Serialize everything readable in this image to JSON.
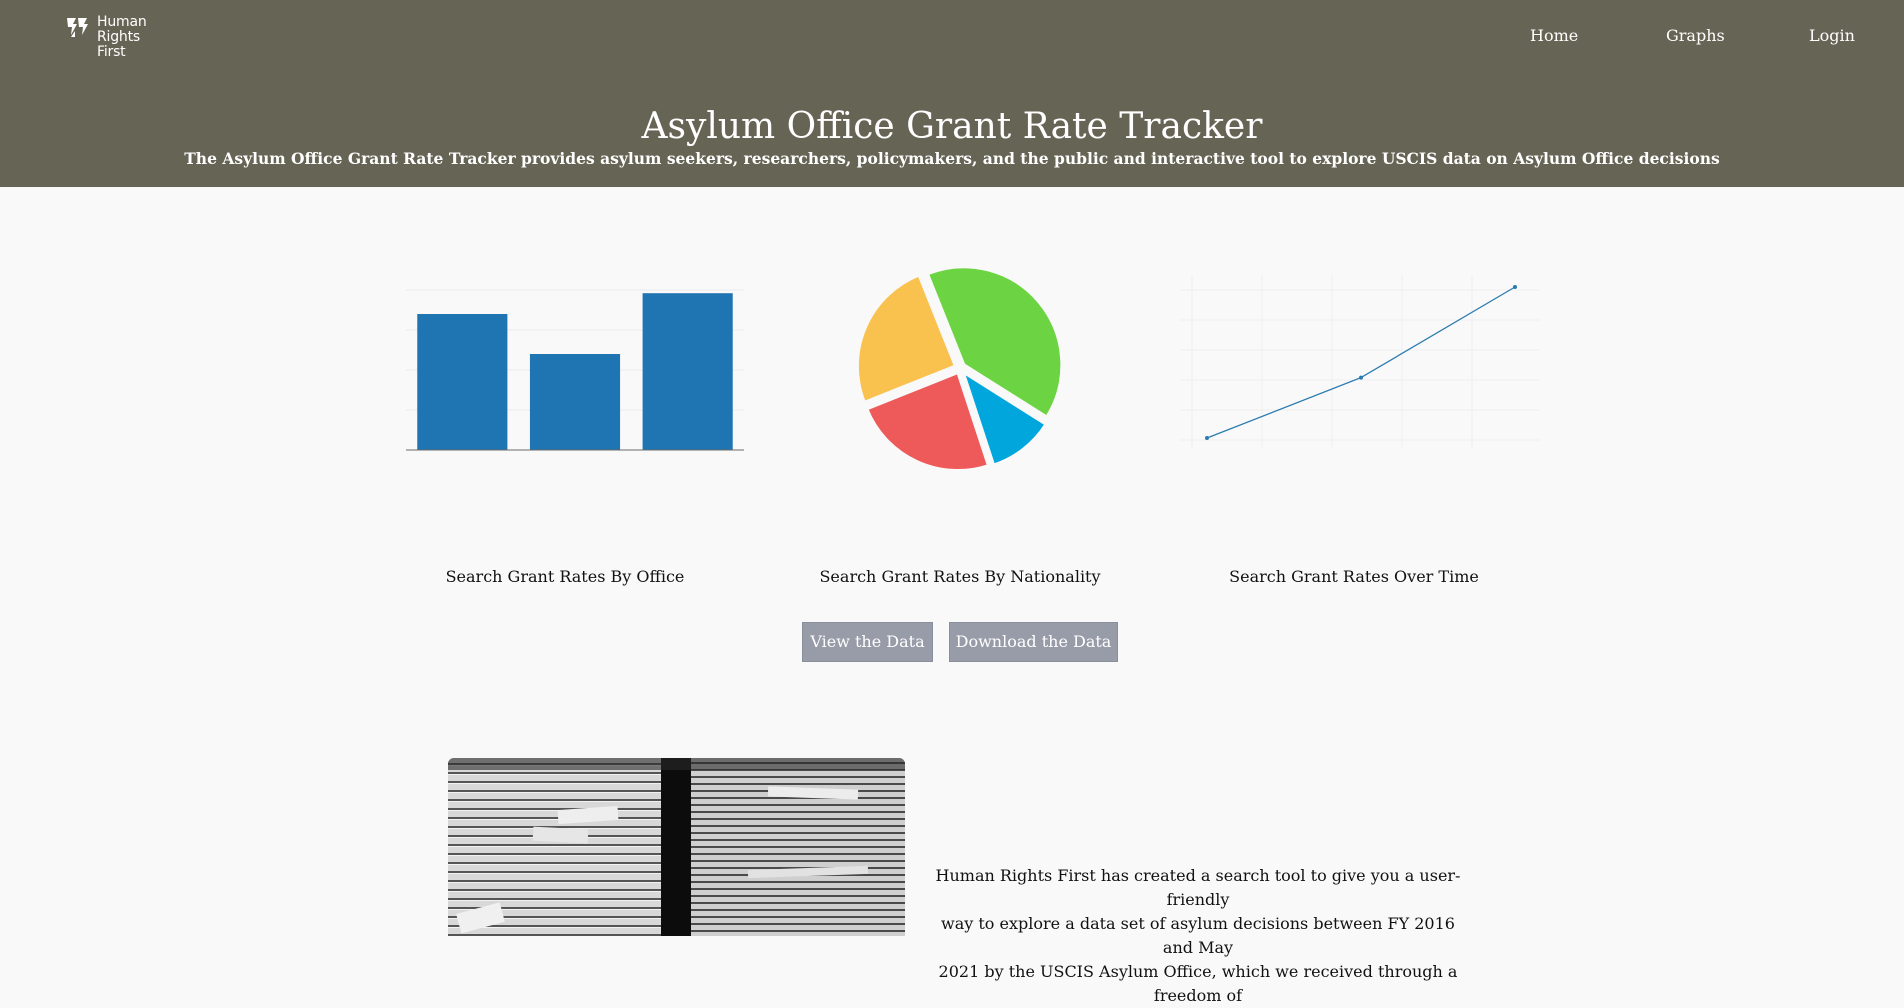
{
  "header": {
    "logo_text": "Human\nRights\nFirst",
    "nav": {
      "home": "Home",
      "graphs": "Graphs",
      "login": "Login"
    },
    "title": "Asylum Office Grant Rate Tracker",
    "subtitle": "The Asylum Office Grant Rate Tracker provides asylum seekers, researchers, policymakers, and the public and interactive tool to explore USCIS data on Asylum Office decisions"
  },
  "colors": {
    "header_bg": "#666555",
    "page_bg": "#f9f9f9",
    "bar_blue": "#1f75b1",
    "pie_green": "#6cd443",
    "pie_blue": "#00a6dc",
    "pie_red": "#ee5a5a",
    "pie_yellow": "#f9c14e",
    "line_blue": "#2b7bb0",
    "button_bg": "#989ca8"
  },
  "cards": [
    {
      "label": "Search Grant Rates By Office"
    },
    {
      "label": "Search Grant Rates By Nationality"
    },
    {
      "label": "Search Grant Rates Over Time"
    }
  ],
  "chart_data": [
    {
      "type": "bar",
      "categories": [
        "",
        "",
        ""
      ],
      "values": [
        85,
        60,
        98
      ],
      "ylim": [
        0,
        100
      ],
      "grid": true,
      "color": "#1f75b1"
    },
    {
      "type": "pie",
      "series": [
        {
          "value": 40,
          "color": "#6cd443"
        },
        {
          "value": 11,
          "color": "#00a6dc"
        },
        {
          "value": 24,
          "color": "#ee5a5a"
        },
        {
          "value": 25,
          "color": "#f9c14e"
        }
      ]
    },
    {
      "type": "line",
      "x": [
        0,
        1,
        2
      ],
      "y": [
        0,
        40,
        100
      ],
      "ylim": [
        0,
        100
      ],
      "grid": true,
      "color": "#2b7bb0"
    }
  ],
  "buttons": {
    "view": "View the Data",
    "download": "Download the Data"
  },
  "intro_text": "Human Rights First has created a search tool to give you a user-friendly\nway to explore a data set of asylum decisions between FY 2016 and May\n2021 by the USCIS Asylum Office, which we received through a freedom of"
}
